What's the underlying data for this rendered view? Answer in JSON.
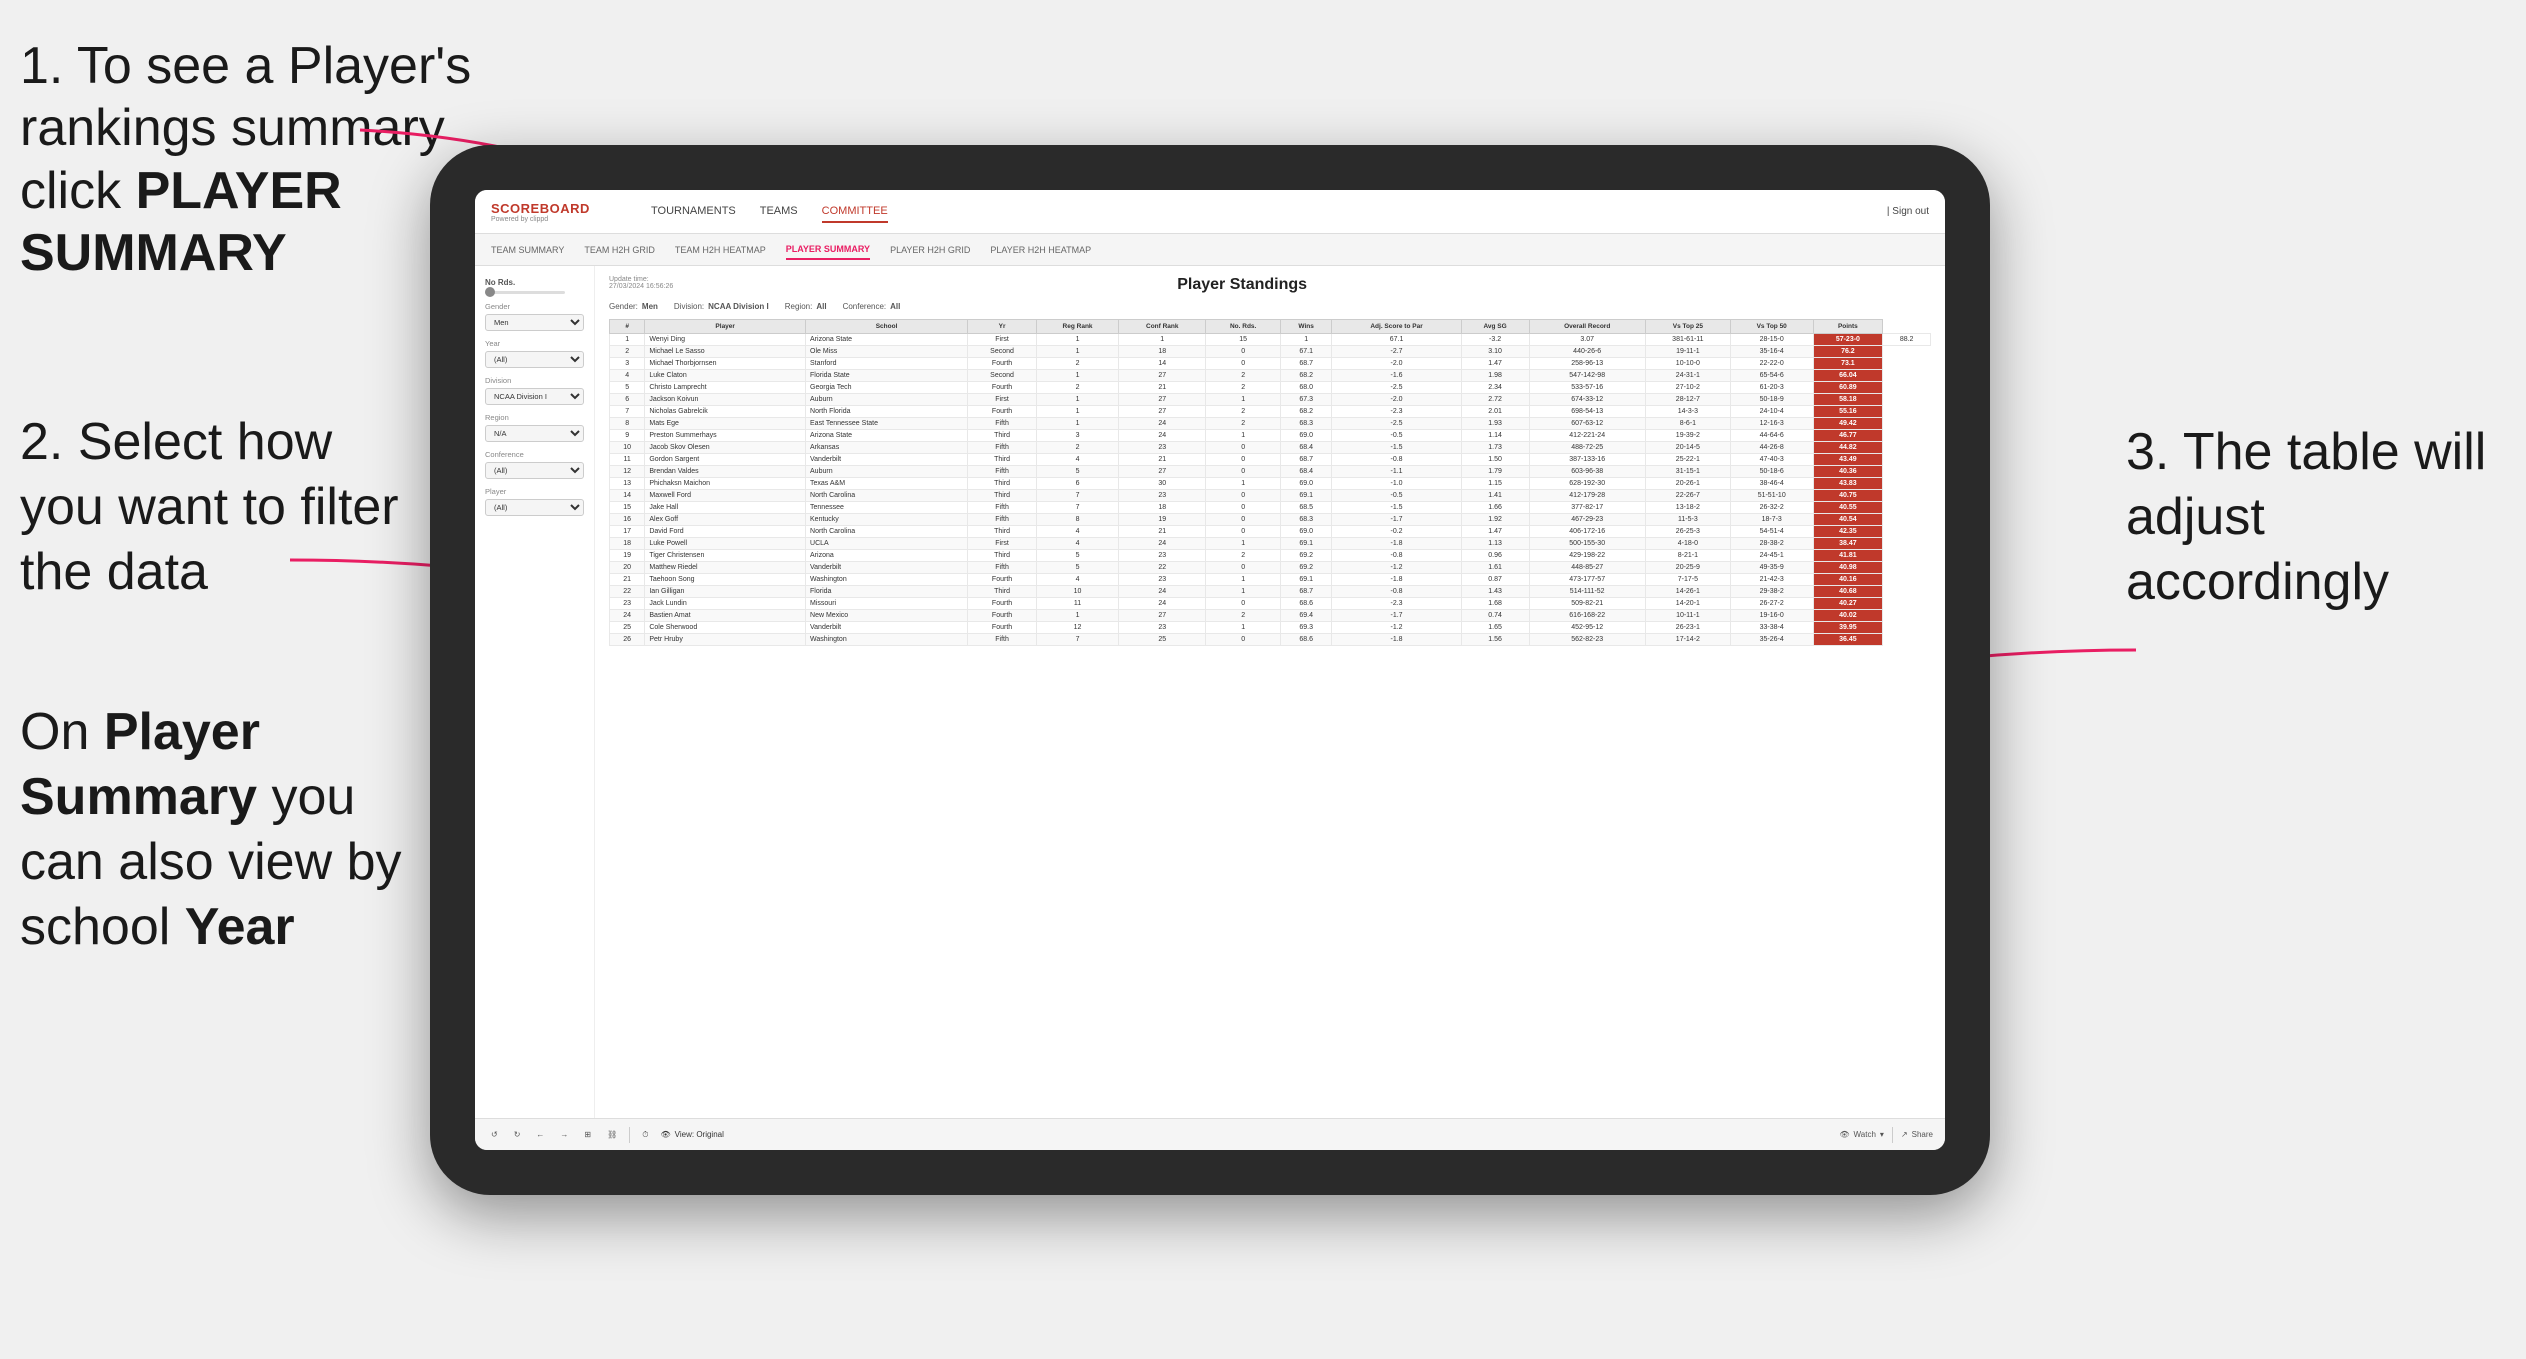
{
  "instructions": {
    "step1": "1. To see a Player's rankings summary click ",
    "step1_bold": "PLAYER SUMMARY",
    "step2": "2. Select how you want to filter the data",
    "step3": "3. The table will adjust accordingly",
    "bottom_note": "On ",
    "bottom_bold1": "Player Summary",
    "bottom_note2": " you can also view by school ",
    "bottom_bold2": "Year"
  },
  "nav": {
    "logo": "SCOREBOARD",
    "logo_sub": "Powered by clippd",
    "items": [
      "TOURNAMENTS",
      "TEAMS",
      "COMMITTEE"
    ],
    "sign_out": "| Sign out"
  },
  "sub_nav": {
    "items": [
      "TEAM SUMMARY",
      "TEAM H2H GRID",
      "TEAM H2H HEATMAP",
      "PLAYER SUMMARY",
      "PLAYER H2H GRID",
      "PLAYER H2H HEATMAP"
    ],
    "active": "PLAYER SUMMARY"
  },
  "sidebar": {
    "no_rds_label": "No Rds.",
    "gender_label": "Gender",
    "gender_value": "Men",
    "year_label": "Year",
    "year_value": "(All)",
    "division_label": "Division",
    "division_value": "NCAA Division I",
    "region_label": "Region",
    "region_value": "N/A",
    "conference_label": "Conference",
    "conference_value": "(All)",
    "player_label": "Player",
    "player_value": "(All)"
  },
  "table": {
    "update_time": "Update time:",
    "update_date": "27/03/2024 16:56:26",
    "title": "Player Standings",
    "filters": {
      "gender_label": "Gender:",
      "gender_value": "Men",
      "division_label": "Division:",
      "division_value": "NCAA Division I",
      "region_label": "Region:",
      "region_value": "All",
      "conference_label": "Conference:",
      "conference_value": "All"
    },
    "columns": [
      "#",
      "Player",
      "School",
      "Yr",
      "Reg Rank",
      "Conf Rank",
      "No. Rds.",
      "Wins",
      "Adj. Score to Par",
      "Avg SG",
      "Overall Record",
      "Vs Top 25",
      "Vs Top 50",
      "Points"
    ],
    "rows": [
      [
        "1",
        "Wenyi Ding",
        "Arizona State",
        "First",
        "1",
        "1",
        "15",
        "1",
        "67.1",
        "-3.2",
        "3.07",
        "381-61-11",
        "28-15-0",
        "57-23-0",
        "88.2"
      ],
      [
        "2",
        "Michael Le Sasso",
        "Ole Miss",
        "Second",
        "1",
        "18",
        "0",
        "67.1",
        "-2.7",
        "3.10",
        "440-26-6",
        "19-11-1",
        "35-16-4",
        "76.2"
      ],
      [
        "3",
        "Michael Thorbjornsen",
        "Stanford",
        "Fourth",
        "2",
        "14",
        "0",
        "68.7",
        "-2.0",
        "1.47",
        "258-96-13",
        "10-10-0",
        "22-22-0",
        "73.1"
      ],
      [
        "4",
        "Luke Claton",
        "Florida State",
        "Second",
        "1",
        "27",
        "2",
        "68.2",
        "-1.6",
        "1.98",
        "547-142-98",
        "24-31-1",
        "65-54-6",
        "66.04"
      ],
      [
        "5",
        "Christo Lamprecht",
        "Georgia Tech",
        "Fourth",
        "2",
        "21",
        "2",
        "68.0",
        "-2.5",
        "2.34",
        "533-57-16",
        "27-10-2",
        "61-20-3",
        "60.89"
      ],
      [
        "6",
        "Jackson Koivun",
        "Auburn",
        "First",
        "1",
        "27",
        "1",
        "67.3",
        "-2.0",
        "2.72",
        "674-33-12",
        "28-12-7",
        "50-18-9",
        "58.18"
      ],
      [
        "7",
        "Nicholas Gabrelcik",
        "North Florida",
        "Fourth",
        "1",
        "27",
        "2",
        "68.2",
        "-2.3",
        "2.01",
        "698-54-13",
        "14-3-3",
        "24-10-4",
        "55.16"
      ],
      [
        "8",
        "Mats Ege",
        "East Tennessee State",
        "Fifth",
        "1",
        "24",
        "2",
        "68.3",
        "-2.5",
        "1.93",
        "607-63-12",
        "8-6-1",
        "12-16-3",
        "49.42"
      ],
      [
        "9",
        "Preston Summerhays",
        "Arizona State",
        "Third",
        "3",
        "24",
        "1",
        "69.0",
        "-0.5",
        "1.14",
        "412-221-24",
        "19-39-2",
        "44-64-6",
        "46.77"
      ],
      [
        "10",
        "Jacob Skov Olesen",
        "Arkansas",
        "Fifth",
        "2",
        "23",
        "0",
        "68.4",
        "-1.5",
        "1.73",
        "488-72-25",
        "20-14-5",
        "44-26-8",
        "44.82"
      ],
      [
        "11",
        "Gordon Sargent",
        "Vanderbilt",
        "Third",
        "4",
        "21",
        "0",
        "68.7",
        "-0.8",
        "1.50",
        "387-133-16",
        "25-22-1",
        "47-40-3",
        "43.49"
      ],
      [
        "12",
        "Brendan Valdes",
        "Auburn",
        "Fifth",
        "5",
        "27",
        "0",
        "68.4",
        "-1.1",
        "1.79",
        "603-96-38",
        "31-15-1",
        "50-18-6",
        "40.36"
      ],
      [
        "13",
        "Phichaksn Maichon",
        "Texas A&M",
        "Third",
        "6",
        "30",
        "1",
        "69.0",
        "-1.0",
        "1.15",
        "628-192-30",
        "20-26-1",
        "38-46-4",
        "43.83"
      ],
      [
        "14",
        "Maxwell Ford",
        "North Carolina",
        "Third",
        "7",
        "23",
        "0",
        "69.1",
        "-0.5",
        "1.41",
        "412-179-28",
        "22-26-7",
        "51-51-10",
        "40.75"
      ],
      [
        "15",
        "Jake Hall",
        "Tennessee",
        "Fifth",
        "7",
        "18",
        "0",
        "68.5",
        "-1.5",
        "1.66",
        "377-82-17",
        "13-18-2",
        "26-32-2",
        "40.55"
      ],
      [
        "16",
        "Alex Goff",
        "Kentucky",
        "Fifth",
        "8",
        "19",
        "0",
        "68.3",
        "-1.7",
        "1.92",
        "467-29-23",
        "11-5-3",
        "18-7-3",
        "40.54"
      ],
      [
        "17",
        "David Ford",
        "North Carolina",
        "Third",
        "4",
        "21",
        "0",
        "69.0",
        "-0.2",
        "1.47",
        "406-172-16",
        "26-25-3",
        "54-51-4",
        "42.35"
      ],
      [
        "18",
        "Luke Powell",
        "UCLA",
        "First",
        "4",
        "24",
        "1",
        "69.1",
        "-1.8",
        "1.13",
        "500-155-30",
        "4-18-0",
        "28-38-2",
        "38.47"
      ],
      [
        "19",
        "Tiger Christensen",
        "Arizona",
        "Third",
        "5",
        "23",
        "2",
        "69.2",
        "-0.8",
        "0.96",
        "429-198-22",
        "8-21-1",
        "24-45-1",
        "41.81"
      ],
      [
        "20",
        "Matthew Riedel",
        "Vanderbilt",
        "Fifth",
        "5",
        "22",
        "0",
        "69.2",
        "-1.2",
        "1.61",
        "448-85-27",
        "20-25-9",
        "49-35-9",
        "40.98"
      ],
      [
        "21",
        "Taehoon Song",
        "Washington",
        "Fourth",
        "4",
        "23",
        "1",
        "69.1",
        "-1.8",
        "0.87",
        "473-177-57",
        "7-17-5",
        "21-42-3",
        "40.16"
      ],
      [
        "22",
        "Ian Gilligan",
        "Florida",
        "Third",
        "10",
        "24",
        "1",
        "68.7",
        "-0.8",
        "1.43",
        "514-111-52",
        "14-26-1",
        "29-38-2",
        "40.68"
      ],
      [
        "23",
        "Jack Lundin",
        "Missouri",
        "Fourth",
        "11",
        "24",
        "0",
        "68.6",
        "-2.3",
        "1.68",
        "509-82-21",
        "14-20-1",
        "26-27-2",
        "40.27"
      ],
      [
        "24",
        "Bastien Amat",
        "New Mexico",
        "Fourth",
        "1",
        "27",
        "2",
        "69.4",
        "-1.7",
        "0.74",
        "616-168-22",
        "10-11-1",
        "19-16-0",
        "40.02"
      ],
      [
        "25",
        "Cole Sherwood",
        "Vanderbilt",
        "Fourth",
        "12",
        "23",
        "1",
        "69.3",
        "-1.2",
        "1.65",
        "452-95-12",
        "26-23-1",
        "33-38-4",
        "39.95"
      ],
      [
        "26",
        "Petr Hruby",
        "Washington",
        "Fifth",
        "7",
        "25",
        "0",
        "68.6",
        "-1.8",
        "1.56",
        "562-82-23",
        "17-14-2",
        "35-26-4",
        "36.45"
      ]
    ]
  },
  "toolbar": {
    "undo": "↺",
    "redo": "↻",
    "back": "←",
    "forward": "→",
    "grid": "⊞",
    "chain": "⛓",
    "divider": "|",
    "clock": "⏱",
    "view_label": "View: Original",
    "watch_label": "Watch",
    "export_label": "Share"
  }
}
